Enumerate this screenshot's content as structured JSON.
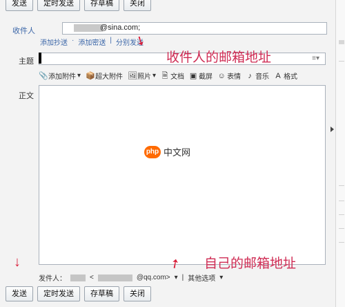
{
  "toolbar": {
    "send": "发送",
    "timed_send": "定时发送",
    "save_draft": "存草稿",
    "close": "关闭"
  },
  "form": {
    "to_label": "收件人",
    "to_email": "@sina.com;",
    "sub_links": [
      "添加抄送",
      "添加密送",
      "分别发送"
    ],
    "subject_label": "主题",
    "subject_hint": "≡▾",
    "body_label": "正文"
  },
  "attachments": {
    "add_attachment": "添加附件",
    "large_attachment": "超大附件",
    "photo": "照片",
    "document": "文档",
    "screenshot": "截屏",
    "emoji": "表情",
    "music": "音乐",
    "format": "格式"
  },
  "footer": {
    "sender_label": "发件人：",
    "sender_email": "@qq.com>",
    "other_options": "其他选项"
  },
  "annotations": {
    "recipient_email_note": "收件人的邮箱地址",
    "self_email_note": "自己的邮箱地址"
  },
  "watermark": {
    "logo": "php",
    "text": "中文网"
  },
  "colors": {
    "accent_link": "#3b66a8",
    "annotation_red": "#cf2b53"
  }
}
